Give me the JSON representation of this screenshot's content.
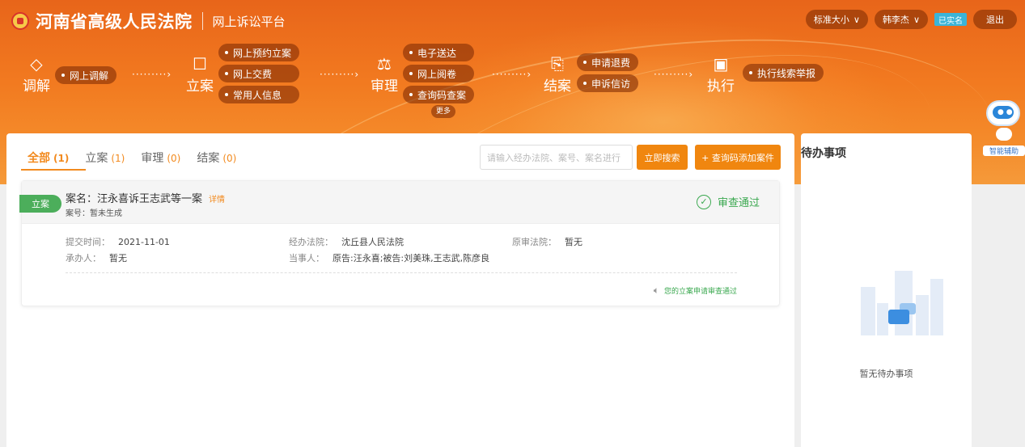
{
  "header": {
    "court_name": "河南省高级人民法院",
    "platform_name": "网上诉讼平台",
    "font_size_label": "标准大小",
    "user_name": "韩李杰",
    "verified_label": "已实名",
    "logout_label": "退出"
  },
  "nav": {
    "stages": [
      {
        "label": "调解",
        "icon": "handshake-icon",
        "items": [
          "网上调解"
        ]
      },
      {
        "label": "立案",
        "icon": "file-icon",
        "items": [
          "网上预约立案",
          "网上交费",
          "常用人信息"
        ]
      },
      {
        "label": "审理",
        "icon": "gavel-icon",
        "items": [
          "电子送达",
          "网上阅卷",
          "查询码查案"
        ]
      },
      {
        "label": "结案",
        "icon": "clipboard-icon",
        "items": [
          "申请退费",
          "申诉信访"
        ]
      },
      {
        "label": "执行",
        "icon": "monitor-icon",
        "items": [
          "执行线索举报"
        ]
      }
    ],
    "more_label": "更多"
  },
  "assistant": {
    "label": "智能辅助"
  },
  "tabs": [
    {
      "label": "全部",
      "count": "(1)"
    },
    {
      "label": "立案",
      "count": "(1)"
    },
    {
      "label": "审理",
      "count": "(0)"
    },
    {
      "label": "结案",
      "count": "(0)"
    }
  ],
  "search": {
    "placeholder": "请输入经办法院、案号、案名进行",
    "search_button": "立即搜索",
    "add_button": "+ 查询码添加案件"
  },
  "case": {
    "badge": "立案",
    "name": "案名：汪永喜诉王志武等一案",
    "detail_link": "详情",
    "case_no": "案号：暂未生成",
    "status": "审查通过",
    "submit_time_label": "提交时间：",
    "submit_time": "2021-11-01",
    "handler_label": "承办人：",
    "handler": "暂无",
    "court_label": "经办法院：",
    "court": "沈丘县人民法院",
    "party_label": "当事人：",
    "party": "原告:汪永喜;被告:刘美珠,王志武,陈彦良",
    "orig_court_label": "原审法院：",
    "orig_court": "暂无",
    "notice": "您的立案申请审查通过"
  },
  "todo": {
    "title": "待办事项",
    "empty_text": "暂无待办事项"
  }
}
